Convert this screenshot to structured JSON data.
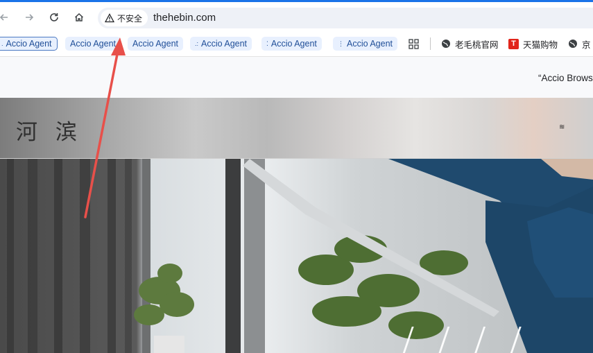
{
  "browser": {
    "security_label": "不安全",
    "url": "thehebin.com",
    "icons": {
      "back": "back-arrow-icon",
      "forward": "forward-arrow-icon",
      "reload": "reload-icon",
      "home": "home-icon",
      "warning": "warning-triangle-icon"
    }
  },
  "bookmarks": {
    "items": [
      {
        "label": "Accio Agent",
        "prefix": "."
      },
      {
        "label": "Accio Agent",
        "prefix": ""
      },
      {
        "label": "Accio Agent",
        "prefix": ""
      },
      {
        "label": "Accio Agent",
        "prefix": ".:"
      },
      {
        "label": "Accio Agent",
        "prefix": "⁚"
      },
      {
        "label": "Accio Agent",
        "prefix": "⋮"
      }
    ],
    "apps_icon": "apps-grid-icon",
    "plain_items": [
      {
        "label": "老毛桃官网",
        "icon": "globe-icon"
      },
      {
        "label": "天猫购物",
        "icon": "tmall-icon"
      },
      {
        "label": "京",
        "icon": "globe-icon"
      }
    ]
  },
  "banner": {
    "text": "“Accio Brows"
  },
  "site": {
    "logo": "河 滨",
    "menu_glyph": "≋"
  },
  "colors": {
    "accent": "#1a73e8",
    "chip_bg": "#e8f0fe",
    "chip_text": "#1f4e97",
    "annotation": "#e8504a"
  }
}
